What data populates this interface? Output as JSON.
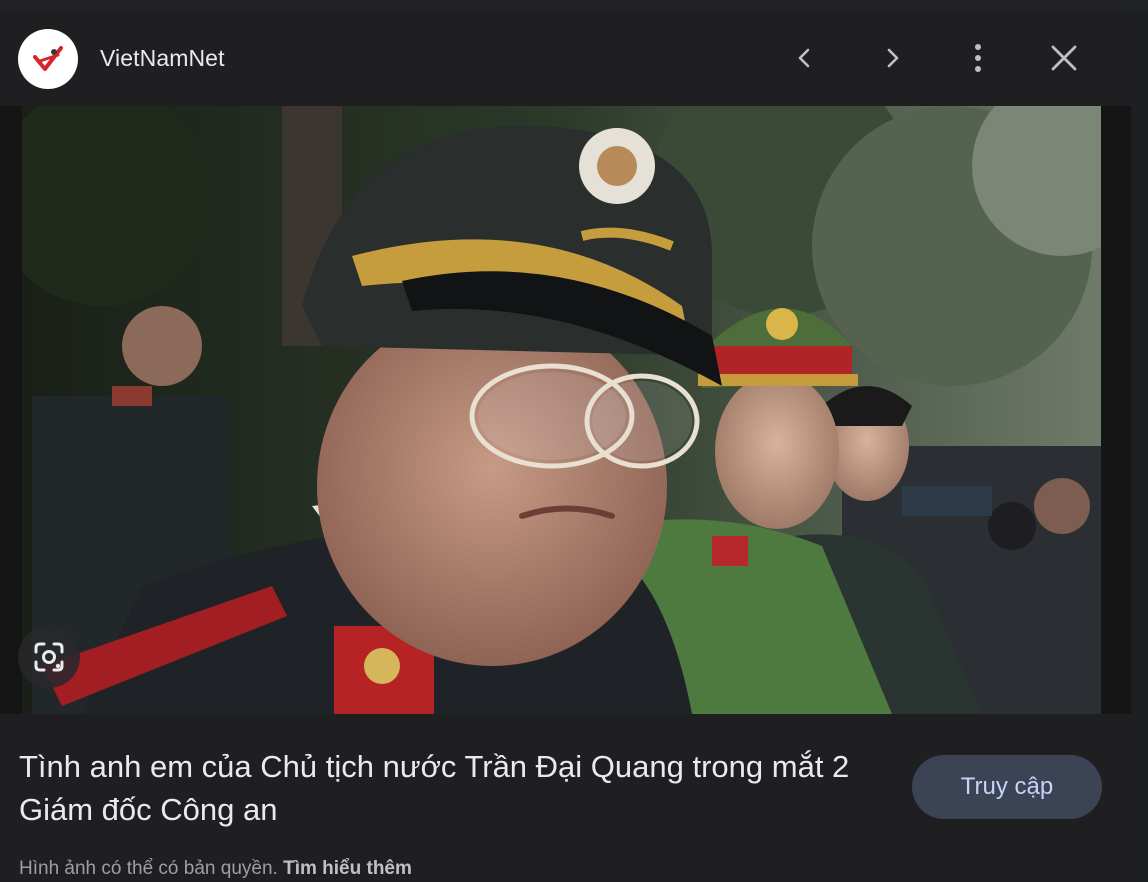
{
  "header": {
    "source_name": "VietNamNet",
    "logo_icon": "vietnamnet-logo-icon",
    "prev_icon": "chevron-left-icon",
    "next_icon": "chevron-right-icon",
    "more_icon": "more-vert-icon",
    "close_icon": "close-icon"
  },
  "image": {
    "lens_icon": "google-lens-icon"
  },
  "result": {
    "title": "Tình anh em của Chủ tịch nước Trần Đại Quang trong mắt 2 Giám đốc Công an",
    "visit_label": "Truy cập"
  },
  "footer": {
    "copyright_text": "Hình ảnh có thể có bản quyền.",
    "learn_more": "Tìm hiểu thêm"
  },
  "colors": {
    "panel_bg": "#1f1f21",
    "text_primary": "#e8eaed",
    "text_secondary": "#9aa0a6",
    "button_bg": "#3c4354",
    "button_text": "#c4d4f5",
    "brand_red": "#d7232a"
  }
}
